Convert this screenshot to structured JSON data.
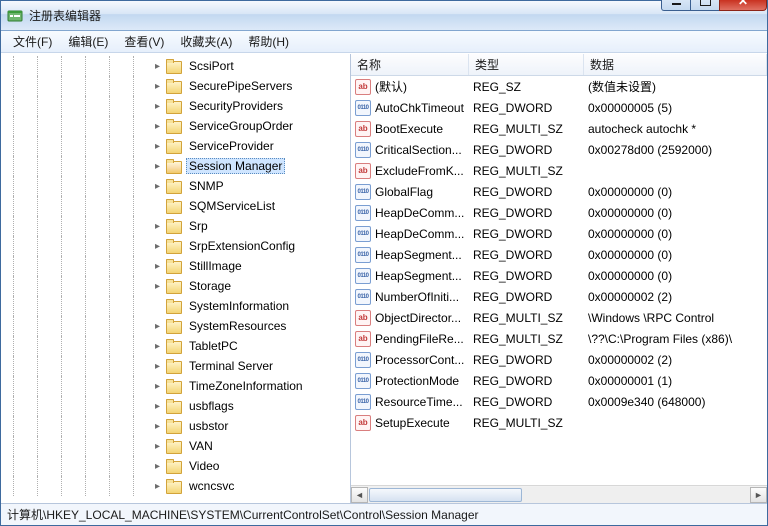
{
  "window": {
    "title": "注册表编辑器"
  },
  "menu": {
    "file": "文件(F)",
    "edit": "编辑(E)",
    "view": "查看(V)",
    "favorites": "收藏夹(A)",
    "help": "帮助(H)"
  },
  "tree": {
    "depthLines": 6,
    "items": [
      {
        "label": "ScsiPort",
        "selected": false,
        "exp": "closed"
      },
      {
        "label": "SecurePipeServers",
        "selected": false,
        "exp": "closed"
      },
      {
        "label": "SecurityProviders",
        "selected": false,
        "exp": "closed"
      },
      {
        "label": "ServiceGroupOrder",
        "selected": false,
        "exp": "closed"
      },
      {
        "label": "ServiceProvider",
        "selected": false,
        "exp": "closed"
      },
      {
        "label": "Session Manager",
        "selected": true,
        "exp": "closed"
      },
      {
        "label": "SNMP",
        "selected": false,
        "exp": "closed"
      },
      {
        "label": "SQMServiceList",
        "selected": false,
        "exp": "none"
      },
      {
        "label": "Srp",
        "selected": false,
        "exp": "closed"
      },
      {
        "label": "SrpExtensionConfig",
        "selected": false,
        "exp": "closed"
      },
      {
        "label": "StillImage",
        "selected": false,
        "exp": "closed"
      },
      {
        "label": "Storage",
        "selected": false,
        "exp": "closed"
      },
      {
        "label": "SystemInformation",
        "selected": false,
        "exp": "none"
      },
      {
        "label": "SystemResources",
        "selected": false,
        "exp": "closed"
      },
      {
        "label": "TabletPC",
        "selected": false,
        "exp": "closed"
      },
      {
        "label": "Terminal Server",
        "selected": false,
        "exp": "closed"
      },
      {
        "label": "TimeZoneInformation",
        "selected": false,
        "exp": "closed"
      },
      {
        "label": "usbflags",
        "selected": false,
        "exp": "closed"
      },
      {
        "label": "usbstor",
        "selected": false,
        "exp": "closed"
      },
      {
        "label": "VAN",
        "selected": false,
        "exp": "closed"
      },
      {
        "label": "Video",
        "selected": false,
        "exp": "closed"
      },
      {
        "label": "wcncsvc",
        "selected": false,
        "exp": "closed"
      }
    ]
  },
  "list": {
    "headers": {
      "name": "名称",
      "type": "类型",
      "data": "数据"
    },
    "rows": [
      {
        "icon": "str",
        "name": "(默认)",
        "type": "REG_SZ",
        "data": "(数值未设置)"
      },
      {
        "icon": "bin",
        "name": "AutoChkTimeout",
        "type": "REG_DWORD",
        "data": "0x00000005 (5)"
      },
      {
        "icon": "str",
        "name": "BootExecute",
        "type": "REG_MULTI_SZ",
        "data": "autocheck autochk *"
      },
      {
        "icon": "bin",
        "name": "CriticalSection...",
        "type": "REG_DWORD",
        "data": "0x00278d00 (2592000)"
      },
      {
        "icon": "str",
        "name": "ExcludeFromK...",
        "type": "REG_MULTI_SZ",
        "data": ""
      },
      {
        "icon": "bin",
        "name": "GlobalFlag",
        "type": "REG_DWORD",
        "data": "0x00000000 (0)"
      },
      {
        "icon": "bin",
        "name": "HeapDeComm...",
        "type": "REG_DWORD",
        "data": "0x00000000 (0)"
      },
      {
        "icon": "bin",
        "name": "HeapDeComm...",
        "type": "REG_DWORD",
        "data": "0x00000000 (0)"
      },
      {
        "icon": "bin",
        "name": "HeapSegment...",
        "type": "REG_DWORD",
        "data": "0x00000000 (0)"
      },
      {
        "icon": "bin",
        "name": "HeapSegment...",
        "type": "REG_DWORD",
        "data": "0x00000000 (0)"
      },
      {
        "icon": "bin",
        "name": "NumberOfIniti...",
        "type": "REG_DWORD",
        "data": "0x00000002 (2)"
      },
      {
        "icon": "str",
        "name": "ObjectDirector...",
        "type": "REG_MULTI_SZ",
        "data": "\\Windows \\RPC Control"
      },
      {
        "icon": "str",
        "name": "PendingFileRe...",
        "type": "REG_MULTI_SZ",
        "data": "\\??\\C:\\Program Files (x86)\\"
      },
      {
        "icon": "bin",
        "name": "ProcessorCont...",
        "type": "REG_DWORD",
        "data": "0x00000002 (2)"
      },
      {
        "icon": "bin",
        "name": "ProtectionMode",
        "type": "REG_DWORD",
        "data": "0x00000001 (1)"
      },
      {
        "icon": "bin",
        "name": "ResourceTime...",
        "type": "REG_DWORD",
        "data": "0x0009e340 (648000)"
      },
      {
        "icon": "str",
        "name": "SetupExecute",
        "type": "REG_MULTI_SZ",
        "data": ""
      }
    ]
  },
  "statusbar": {
    "path": "计算机\\HKEY_LOCAL_MACHINE\\SYSTEM\\CurrentControlSet\\Control\\Session Manager"
  },
  "chart_data": null
}
